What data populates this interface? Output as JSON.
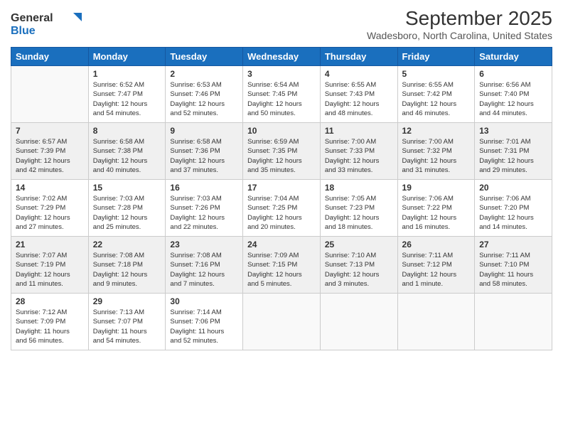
{
  "logo": {
    "general": "General",
    "blue": "Blue"
  },
  "title": "September 2025",
  "location": "Wadesboro, North Carolina, United States",
  "headers": [
    "Sunday",
    "Monday",
    "Tuesday",
    "Wednesday",
    "Thursday",
    "Friday",
    "Saturday"
  ],
  "weeks": [
    [
      {
        "day": "",
        "info": ""
      },
      {
        "day": "1",
        "info": "Sunrise: 6:52 AM\nSunset: 7:47 PM\nDaylight: 12 hours\nand 54 minutes."
      },
      {
        "day": "2",
        "info": "Sunrise: 6:53 AM\nSunset: 7:46 PM\nDaylight: 12 hours\nand 52 minutes."
      },
      {
        "day": "3",
        "info": "Sunrise: 6:54 AM\nSunset: 7:45 PM\nDaylight: 12 hours\nand 50 minutes."
      },
      {
        "day": "4",
        "info": "Sunrise: 6:55 AM\nSunset: 7:43 PM\nDaylight: 12 hours\nand 48 minutes."
      },
      {
        "day": "5",
        "info": "Sunrise: 6:55 AM\nSunset: 7:42 PM\nDaylight: 12 hours\nand 46 minutes."
      },
      {
        "day": "6",
        "info": "Sunrise: 6:56 AM\nSunset: 7:40 PM\nDaylight: 12 hours\nand 44 minutes."
      }
    ],
    [
      {
        "day": "7",
        "info": "Sunrise: 6:57 AM\nSunset: 7:39 PM\nDaylight: 12 hours\nand 42 minutes."
      },
      {
        "day": "8",
        "info": "Sunrise: 6:58 AM\nSunset: 7:38 PM\nDaylight: 12 hours\nand 40 minutes."
      },
      {
        "day": "9",
        "info": "Sunrise: 6:58 AM\nSunset: 7:36 PM\nDaylight: 12 hours\nand 37 minutes."
      },
      {
        "day": "10",
        "info": "Sunrise: 6:59 AM\nSunset: 7:35 PM\nDaylight: 12 hours\nand 35 minutes."
      },
      {
        "day": "11",
        "info": "Sunrise: 7:00 AM\nSunset: 7:33 PM\nDaylight: 12 hours\nand 33 minutes."
      },
      {
        "day": "12",
        "info": "Sunrise: 7:00 AM\nSunset: 7:32 PM\nDaylight: 12 hours\nand 31 minutes."
      },
      {
        "day": "13",
        "info": "Sunrise: 7:01 AM\nSunset: 7:31 PM\nDaylight: 12 hours\nand 29 minutes."
      }
    ],
    [
      {
        "day": "14",
        "info": "Sunrise: 7:02 AM\nSunset: 7:29 PM\nDaylight: 12 hours\nand 27 minutes."
      },
      {
        "day": "15",
        "info": "Sunrise: 7:03 AM\nSunset: 7:28 PM\nDaylight: 12 hours\nand 25 minutes."
      },
      {
        "day": "16",
        "info": "Sunrise: 7:03 AM\nSunset: 7:26 PM\nDaylight: 12 hours\nand 22 minutes."
      },
      {
        "day": "17",
        "info": "Sunrise: 7:04 AM\nSunset: 7:25 PM\nDaylight: 12 hours\nand 20 minutes."
      },
      {
        "day": "18",
        "info": "Sunrise: 7:05 AM\nSunset: 7:23 PM\nDaylight: 12 hours\nand 18 minutes."
      },
      {
        "day": "19",
        "info": "Sunrise: 7:06 AM\nSunset: 7:22 PM\nDaylight: 12 hours\nand 16 minutes."
      },
      {
        "day": "20",
        "info": "Sunrise: 7:06 AM\nSunset: 7:20 PM\nDaylight: 12 hours\nand 14 minutes."
      }
    ],
    [
      {
        "day": "21",
        "info": "Sunrise: 7:07 AM\nSunset: 7:19 PM\nDaylight: 12 hours\nand 11 minutes."
      },
      {
        "day": "22",
        "info": "Sunrise: 7:08 AM\nSunset: 7:18 PM\nDaylight: 12 hours\nand 9 minutes."
      },
      {
        "day": "23",
        "info": "Sunrise: 7:08 AM\nSunset: 7:16 PM\nDaylight: 12 hours\nand 7 minutes."
      },
      {
        "day": "24",
        "info": "Sunrise: 7:09 AM\nSunset: 7:15 PM\nDaylight: 12 hours\nand 5 minutes."
      },
      {
        "day": "25",
        "info": "Sunrise: 7:10 AM\nSunset: 7:13 PM\nDaylight: 12 hours\nand 3 minutes."
      },
      {
        "day": "26",
        "info": "Sunrise: 7:11 AM\nSunset: 7:12 PM\nDaylight: 12 hours\nand 1 minute."
      },
      {
        "day": "27",
        "info": "Sunrise: 7:11 AM\nSunset: 7:10 PM\nDaylight: 11 hours\nand 58 minutes."
      }
    ],
    [
      {
        "day": "28",
        "info": "Sunrise: 7:12 AM\nSunset: 7:09 PM\nDaylight: 11 hours\nand 56 minutes."
      },
      {
        "day": "29",
        "info": "Sunrise: 7:13 AM\nSunset: 7:07 PM\nDaylight: 11 hours\nand 54 minutes."
      },
      {
        "day": "30",
        "info": "Sunrise: 7:14 AM\nSunset: 7:06 PM\nDaylight: 11 hours\nand 52 minutes."
      },
      {
        "day": "",
        "info": ""
      },
      {
        "day": "",
        "info": ""
      },
      {
        "day": "",
        "info": ""
      },
      {
        "day": "",
        "info": ""
      }
    ]
  ]
}
